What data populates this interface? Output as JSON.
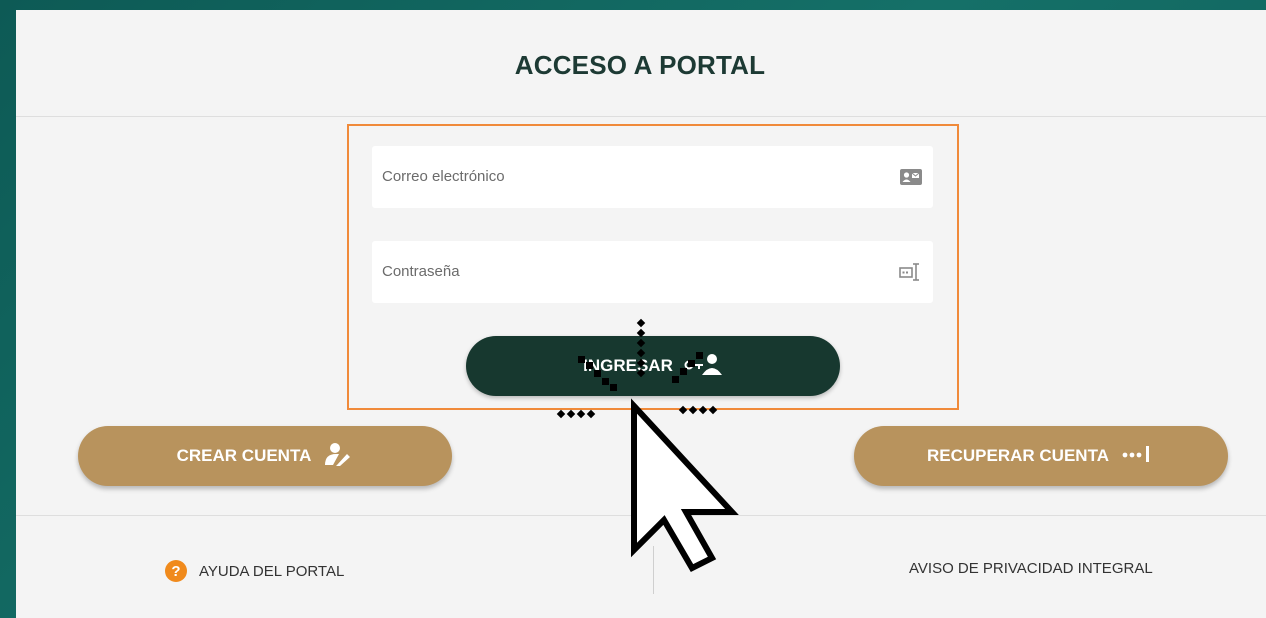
{
  "header": {
    "title": "ACCESO A PORTAL"
  },
  "form": {
    "email": {
      "placeholder": "Correo electrónico",
      "icon": "id-card-icon"
    },
    "password": {
      "placeholder": "Contraseña",
      "icon": "text-cursor-icon"
    },
    "login_label": "INGRESAR"
  },
  "actions": {
    "create_label": "CREAR CUENTA",
    "recover_label": "RECUPERAR CUENTA"
  },
  "footer": {
    "help_label": "AYUDA DEL PORTAL",
    "help_icon_glyph": "?",
    "privacy_label": "AVISO DE PRIVACIDAD INTEGRAL"
  },
  "colors": {
    "background": "#157068",
    "panel": "#f4f4f4",
    "primary_button": "#17382f",
    "gold_button": "#b8935d",
    "highlight_border": "#f08a3a",
    "help_icon": "#f08a1c"
  }
}
